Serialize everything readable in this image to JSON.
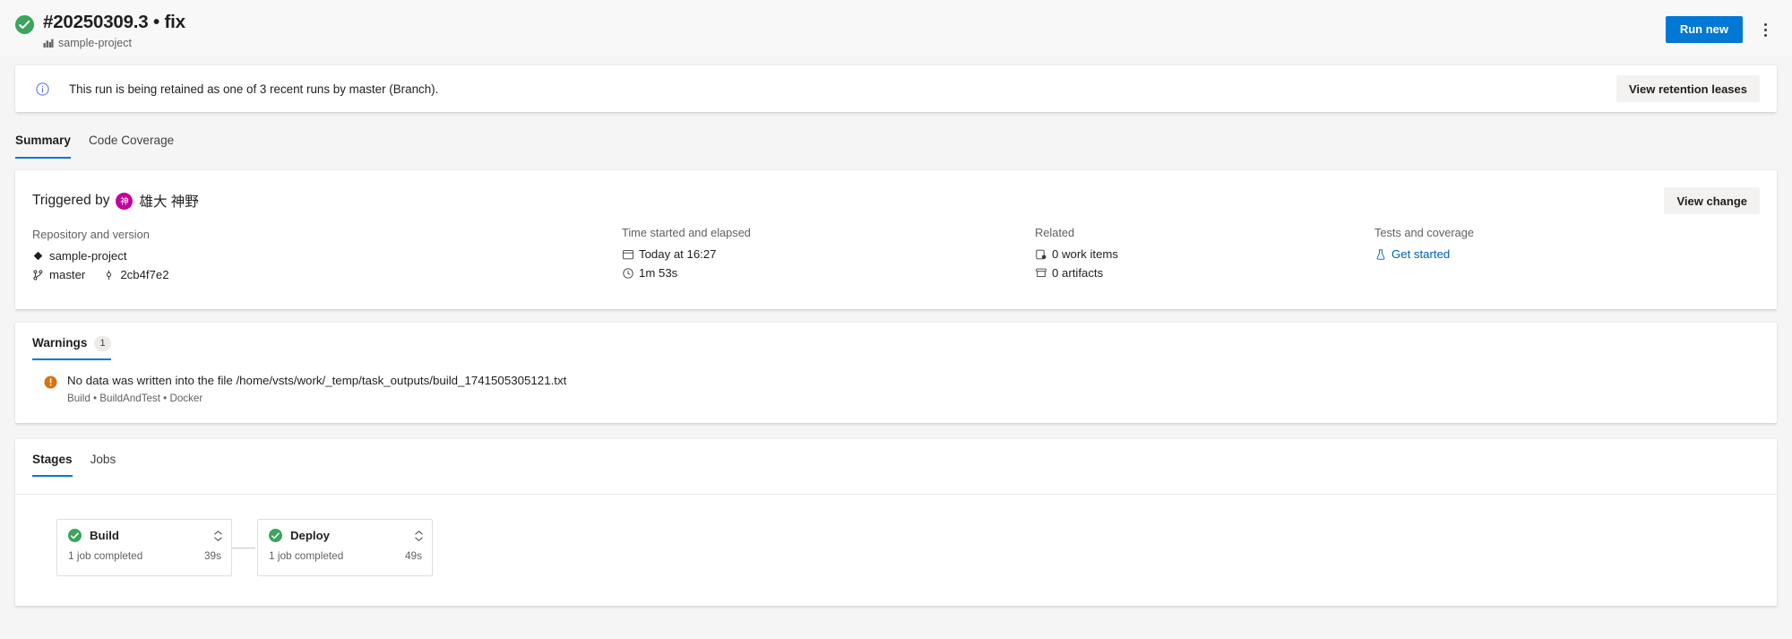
{
  "header": {
    "status_icon": "check-circle-success",
    "status_color": "#3aa55c",
    "title": "#20250309.3 • fix",
    "project_icon": "pipeline-icon",
    "project": "sample-project",
    "run_new_label": "Run new",
    "run_new_color": "#0078d4",
    "more_actions_icon": "kebab-menu-icon"
  },
  "banner": {
    "info_icon": "info-circle-icon",
    "message": "This run is being retained as one of 3 recent runs by master (Branch).",
    "action_label": "View retention leases"
  },
  "page_tabs": [
    {
      "label": "Summary",
      "active": true
    },
    {
      "label": "Code Coverage",
      "active": false
    }
  ],
  "summary": {
    "triggered_by_label": "Triggered by",
    "avatar_initial": "神",
    "avatar_color": "#c4009e",
    "user_name": "雄大 神野",
    "view_change_label": "View change",
    "columns": {
      "repository": {
        "title": "Repository and version",
        "repo_icon": "repository-icon",
        "repo_name": "sample-project",
        "branch_icon": "branch-icon",
        "branch_name": "master",
        "commit_icon": "commit-icon",
        "commit_hash": "2cb4f7e2"
      },
      "time": {
        "title": "Time started and elapsed",
        "calendar_icon": "calendar-icon",
        "started": "Today at 16:27",
        "clock_icon": "clock-icon",
        "elapsed": "1m 53s"
      },
      "related": {
        "title": "Related",
        "work_items_icon": "work-item-icon",
        "work_items": "0 work items",
        "artifacts_icon": "artifact-icon",
        "artifacts": "0 artifacts"
      },
      "tests": {
        "title": "Tests and coverage",
        "beaker_icon": "beaker-icon",
        "link_label": "Get started",
        "link_color": "#005fb8"
      }
    }
  },
  "warnings": {
    "tabs": [
      {
        "label": "Warnings",
        "count": "1",
        "active": true
      }
    ],
    "items": [
      {
        "icon": "warning-icon",
        "icon_color": "#d9730d",
        "message": "No data was written into the file /home/vsts/work/_temp/task_outputs/build_1741505305121.txt",
        "meta": "Build • BuildAndTest • Docker"
      }
    ]
  },
  "stages": {
    "tabs": [
      {
        "label": "Stages",
        "active": true
      },
      {
        "label": "Jobs",
        "active": false
      }
    ],
    "items": [
      {
        "status_icon": "check-circle-success",
        "name": "Build",
        "expand_icon": "chevron-updown-icon",
        "jobs_summary": "1 job completed",
        "duration": "39s"
      },
      {
        "status_icon": "check-circle-success",
        "name": "Deploy",
        "expand_icon": "chevron-updown-icon",
        "jobs_summary": "1 job completed",
        "duration": "49s"
      }
    ]
  }
}
